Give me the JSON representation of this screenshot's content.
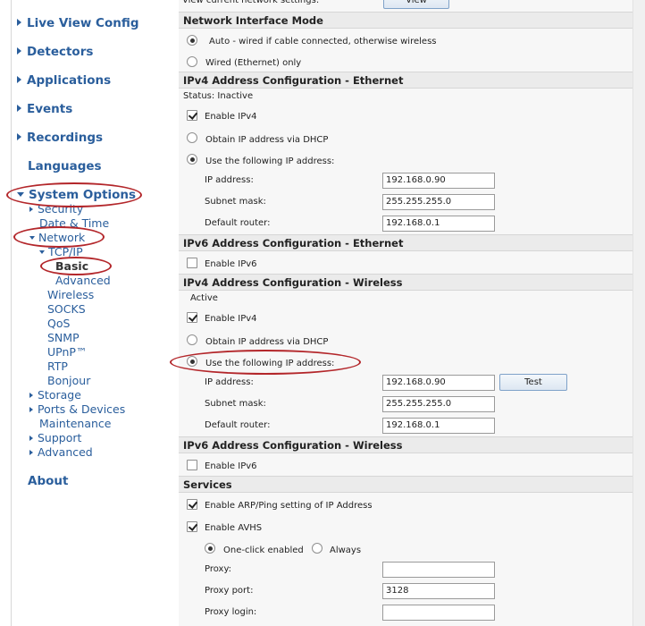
{
  "sidebar": {
    "main_items": [
      {
        "label": "Live View Config"
      },
      {
        "label": "Detectors"
      },
      {
        "label": "Applications"
      },
      {
        "label": "Events"
      },
      {
        "label": "Recordings"
      },
      {
        "label": "Languages"
      },
      {
        "label": "System Options"
      },
      {
        "label": "About"
      }
    ],
    "sub_items": {
      "security": "Security",
      "date_time": "Date & Time",
      "network": "Network",
      "tcpip": "TCP/IP",
      "basic": "Basic",
      "advanced_tcp": "Advanced",
      "wireless": "Wireless",
      "socks": "SOCKS",
      "qos": "QoS",
      "snmp": "SNMP",
      "upnp": "UPnP™",
      "rtp": "RTP",
      "bonjour": "Bonjour",
      "storage": "Storage",
      "ports_devices": "Ports & Devices",
      "maintenance": "Maintenance",
      "support": "Support",
      "advanced": "Advanced"
    }
  },
  "main": {
    "view_row": {
      "label": "View current network settings:",
      "button": "View"
    },
    "network_mode": {
      "header": "Network Interface Mode",
      "auto_label": "Auto - wired if cable connected, otherwise wireless",
      "wired_label": "Wired (Ethernet) only"
    },
    "ipv4_eth": {
      "header": "IPv4 Address Configuration - Ethernet",
      "status": "Status: Inactive",
      "enable_label": "Enable IPv4",
      "dhcp_label": "Obtain IP address via DHCP",
      "static_label": "Use the following IP address:",
      "ip_label": "IP address:",
      "ip_value": "192.168.0.90",
      "subnet_label": "Subnet mask:",
      "subnet_value": "255.255.255.0",
      "router_label": "Default router:",
      "router_value": "192.168.0.1"
    },
    "ipv6_eth": {
      "header": "IPv6 Address Configuration - Ethernet",
      "enable_label": "Enable IPv6"
    },
    "ipv4_wl": {
      "header": "IPv4 Address Configuration - Wireless",
      "status": "Active",
      "enable_label": "Enable IPv4",
      "dhcp_label": "Obtain IP address via DHCP",
      "static_label": "Use the following IP address:",
      "ip_label": "IP address:",
      "ip_value": "192.168.0.90",
      "test_button": "Test",
      "subnet_label": "Subnet mask:",
      "subnet_value": "255.255.255.0",
      "router_label": "Default router:",
      "router_value": "192.168.0.1"
    },
    "ipv6_wl": {
      "header": "IPv6 Address Configuration - Wireless",
      "enable_label": "Enable IPv6"
    },
    "services": {
      "header": "Services",
      "arp_label": "Enable ARP/Ping setting of IP Address",
      "avhs_label": "Enable AVHS",
      "oneclick_label": "One-click enabled",
      "always_label": "Always",
      "proxy_label": "Proxy:",
      "proxy_value": "",
      "proxy_port_label": "Proxy port:",
      "proxy_port_value": "3128",
      "proxy_login_label": "Proxy login:",
      "proxy_login_value": ""
    }
  },
  "colors": {
    "link": "#2a5e9c",
    "annotation": "#b3262a",
    "section_header_bg": "#ebebeb"
  }
}
